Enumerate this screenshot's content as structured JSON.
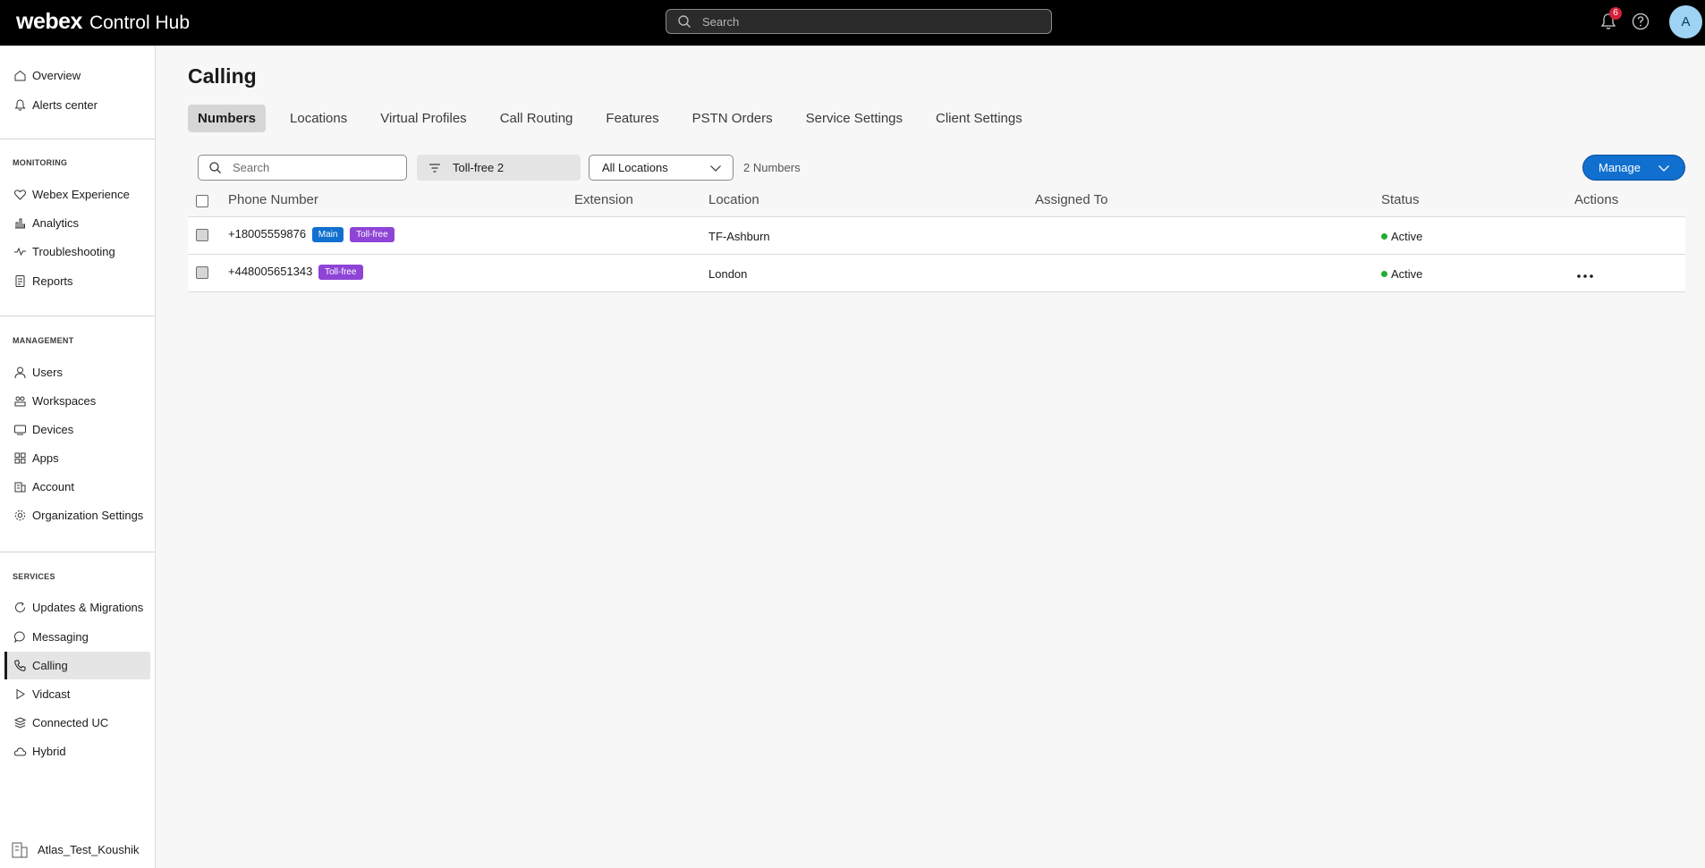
{
  "header": {
    "brand_word": "webex",
    "brand_product": "Control Hub",
    "search_placeholder": "Search",
    "notifications_count": "6",
    "avatar_initial": "A"
  },
  "sidebar": {
    "top_items": [
      {
        "label": "Overview",
        "icon": "home-icon"
      },
      {
        "label": "Alerts center",
        "icon": "bell-icon"
      }
    ],
    "monitoring_label": "MONITORING",
    "monitoring_items": [
      {
        "label": "Webex Experience",
        "icon": "heart-icon"
      },
      {
        "label": "Analytics",
        "icon": "bar-chart-icon"
      },
      {
        "label": "Troubleshooting",
        "icon": "pulse-icon"
      },
      {
        "label": "Reports",
        "icon": "report-icon"
      }
    ],
    "management_label": "MANAGEMENT",
    "management_items": [
      {
        "label": "Users",
        "icon": "user-icon"
      },
      {
        "label": "Workspaces",
        "icon": "workspaces-icon"
      },
      {
        "label": "Devices",
        "icon": "device-icon"
      },
      {
        "label": "Apps",
        "icon": "apps-icon"
      },
      {
        "label": "Account",
        "icon": "account-icon"
      },
      {
        "label": "Organization Settings",
        "icon": "gear-icon"
      }
    ],
    "services_label": "SERVICES",
    "services_items": [
      {
        "label": "Updates & Migrations",
        "icon": "refresh-icon"
      },
      {
        "label": "Messaging",
        "icon": "chat-icon"
      },
      {
        "label": "Calling",
        "icon": "phone-icon",
        "active": true
      },
      {
        "label": "Vidcast",
        "icon": "play-icon"
      },
      {
        "label": "Connected UC",
        "icon": "layers-icon"
      },
      {
        "label": "Hybrid",
        "icon": "cloud-icon"
      }
    ],
    "org_name": "Atlas_Test_Koushik"
  },
  "main": {
    "title": "Calling",
    "tabs": [
      {
        "label": "Numbers",
        "active": true
      },
      {
        "label": "Locations"
      },
      {
        "label": "Virtual Profiles"
      },
      {
        "label": "Call Routing"
      },
      {
        "label": "Features"
      },
      {
        "label": "PSTN Orders"
      },
      {
        "label": "Service Settings"
      },
      {
        "label": "Client Settings"
      }
    ],
    "search_placeholder": "Search",
    "filter_label": "Toll-free 2",
    "location_select": "All Locations",
    "count_label": "2 Numbers",
    "manage_label": "Manage",
    "columns": [
      "Phone Number",
      "Extension",
      "Location",
      "Assigned To",
      "Status",
      "Actions"
    ],
    "rows": [
      {
        "phone": "+18005559876",
        "tags": [
          "Main",
          "Toll-free"
        ],
        "extension": "",
        "location": "TF-Ashburn",
        "assigned_to": "",
        "status": "Active",
        "has_actions": false
      },
      {
        "phone": "+448005651343",
        "tags": [
          "Toll-free"
        ],
        "extension": "",
        "location": "London",
        "assigned_to": "",
        "status": "Active",
        "has_actions": true
      }
    ]
  },
  "colors": {
    "accent": "#1170cf",
    "toll_free_tag": "#8e44d6",
    "status_active": "#24ab31",
    "notification_badge": "#d4213b"
  }
}
